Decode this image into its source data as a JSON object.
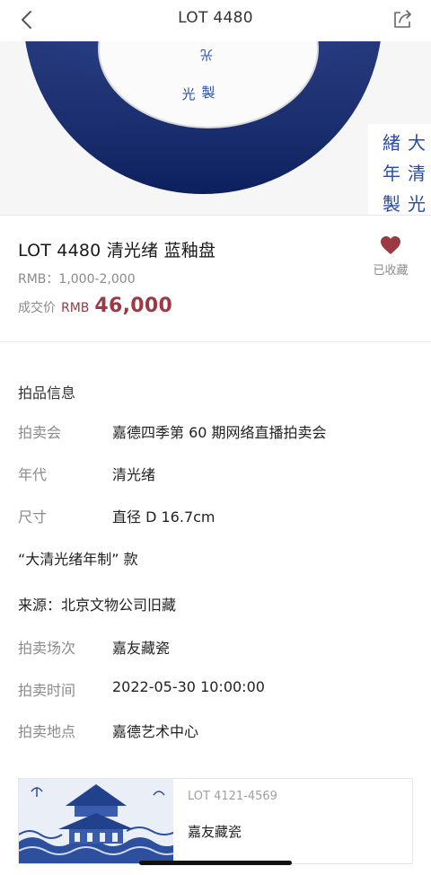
{
  "nav": {
    "title": "LOT 4480",
    "back_icon": "chevron-left-icon",
    "share_icon": "share-icon"
  },
  "hero": {
    "mark_left_col": "光\n製",
    "mark_right": [
      "大清",
      "緒光",
      "年",
      "製"
    ]
  },
  "lot": {
    "title": "LOT 4480 清光绪  蓝釉盘",
    "estimate": "RMB：1,000-2,000",
    "deal_label": "成交价",
    "deal_currency": "RMB",
    "deal_price": "46,000",
    "price_color": "#9c3a44"
  },
  "favorite": {
    "label": "已收藏",
    "icon": "heart-icon",
    "color": "#9c3a44"
  },
  "info": {
    "section_title": "拍品信息",
    "rows": [
      {
        "key": "拍卖会",
        "value": "嘉德四季第 60 期网络直播拍卖会"
      },
      {
        "key": "年代",
        "value": "清光绪"
      },
      {
        "key": "尺寸",
        "value": "直径 D 16.7cm"
      }
    ],
    "mark_text": "“大清光绪年制” 款",
    "provenance": "来源：北京文物公司旧藏",
    "session_rows": [
      {
        "key": "拍卖场次",
        "value": "嘉友藏瓷"
      },
      {
        "key": "拍卖时间",
        "value": "2022-05-30 10:00:00"
      },
      {
        "key": "拍卖地点",
        "value": "嘉德艺术中心"
      }
    ]
  },
  "card": {
    "range": "LOT 4121-4569",
    "name": "嘉友藏瓷"
  }
}
